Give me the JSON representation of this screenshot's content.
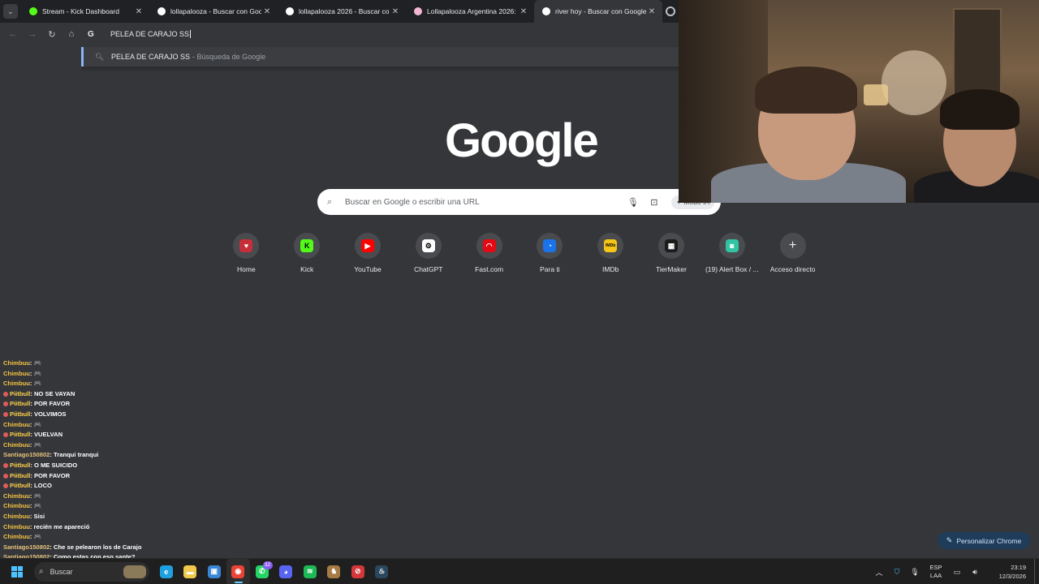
{
  "browser": {
    "tabs": [
      {
        "title": "Stream - Kick Dashboard",
        "favicon_color": "#53fc18",
        "active": false
      },
      {
        "title": "lollapalooza - Buscar con Goog",
        "favicon_color": "#ffffff",
        "active": false
      },
      {
        "title": "lollapalooza 2026 - Buscar con",
        "favicon_color": "#ffffff",
        "active": false
      },
      {
        "title": "Lollapalooza Argentina 2026: e",
        "favicon_color": "#f4b6d2",
        "active": false
      },
      {
        "title": "river hoy - Buscar con Google",
        "favicon_color": "#ffffff",
        "active": true
      }
    ],
    "tab_close_glyph": "✕",
    "omnibox": {
      "value": "PELEA DE CARAJO SS",
      "engine_icon": "G"
    },
    "suggestion": {
      "query": "PELEA DE CARAJO SS",
      "source": "- Búsqueda de Google"
    }
  },
  "ntp": {
    "logo": "Google",
    "search_placeholder": "Buscar en Google o escribir una URL",
    "ai_mode_label": "Modo IA",
    "shortcuts": [
      {
        "label": "Home",
        "icon": "home-shield-icon",
        "color": "#c62f3a",
        "glyph": "♥"
      },
      {
        "label": "Kick",
        "icon": "kick-icon",
        "color": "#53fc18",
        "glyph": "K"
      },
      {
        "label": "YouTube",
        "icon": "youtube-icon",
        "color": "#ff0000",
        "glyph": "▶"
      },
      {
        "label": "ChatGPT",
        "icon": "chatgpt-icon",
        "color": "#ffffff",
        "glyph": "⚙"
      },
      {
        "label": "Fast.com",
        "icon": "fast-icon",
        "color": "#e50914",
        "glyph": "◠"
      },
      {
        "label": "Para ti",
        "icon": "para-ti-icon",
        "color": "#1a73e8",
        "glyph": "◔"
      },
      {
        "label": "IMDb",
        "icon": "imdb-icon",
        "color": "#f5c518",
        "glyph": "IMDb"
      },
      {
        "label": "TierMaker",
        "icon": "tiermaker-icon",
        "color": "#1b1b1b",
        "glyph": "▦"
      },
      {
        "label": "(19) Alert Box / ...",
        "icon": "alert-box-icon",
        "color": "#31c3a2",
        "glyph": "◙"
      },
      {
        "label": "Acceso directo",
        "icon": "plus-icon",
        "color": "#4a4b4f",
        "glyph": "+"
      }
    ],
    "customize_label": "Personalizar Chrome"
  },
  "chat": [
    {
      "user": "Chimbuu",
      "msg": "🎮",
      "color": "#f5c542",
      "badge": false
    },
    {
      "user": "Chimbuu",
      "msg": "🎮",
      "color": "#f5c542",
      "badge": false
    },
    {
      "user": "Chimbuu",
      "msg": "🎮",
      "color": "#f5c542",
      "badge": false
    },
    {
      "user": "Piitbull",
      "msg": "NO SE VAYAN",
      "color": "#ffd24a",
      "badge": true
    },
    {
      "user": "Piitbull",
      "msg": "POR FAVOR",
      "color": "#ffd24a",
      "badge": true
    },
    {
      "user": "Piitbull",
      "msg": "VOLVIMOS",
      "color": "#ffd24a",
      "badge": true
    },
    {
      "user": "Chimbuu",
      "msg": "🎮",
      "color": "#f5c542",
      "badge": false
    },
    {
      "user": "Piitbull",
      "msg": "VUELVAN",
      "color": "#ffd24a",
      "badge": true
    },
    {
      "user": "Chimbuu",
      "msg": "🎮",
      "color": "#f5c542",
      "badge": false
    },
    {
      "user": "Santiago150802",
      "msg": "Tranqui tranqui",
      "color": "#e6c27a",
      "badge": false
    },
    {
      "user": "Piitbull",
      "msg": "O ME SUICIDO",
      "color": "#ffd24a",
      "badge": true
    },
    {
      "user": "Piitbull",
      "msg": "POR FAVOR",
      "color": "#ffd24a",
      "badge": true
    },
    {
      "user": "Piitbull",
      "msg": "LOCO",
      "color": "#ffd24a",
      "badge": true
    },
    {
      "user": "Chimbuu",
      "msg": "🎮",
      "color": "#f5c542",
      "badge": false
    },
    {
      "user": "Chimbuu",
      "msg": "🎮",
      "color": "#f5c542",
      "badge": false
    },
    {
      "user": "Chimbuu",
      "msg": "Sisi",
      "color": "#f5c542",
      "badge": false
    },
    {
      "user": "Chimbuu",
      "msg": "recién me apareció",
      "color": "#f5c542",
      "badge": false
    },
    {
      "user": "Chimbuu",
      "msg": "🎮",
      "color": "#f5c542",
      "badge": false
    },
    {
      "user": "Santiago150802",
      "msg": "Che se pelearon los de Carajo",
      "color": "#e6c27a",
      "badge": false
    },
    {
      "user": "Santiago150802",
      "msg": "Como estas con eso sante?",
      "color": "#e6c27a",
      "badge": false
    }
  ],
  "taskbar": {
    "search_label": "Buscar",
    "apps": [
      {
        "name": "edge-icon",
        "color": "#1fa0e0",
        "glyph": "e",
        "active": false,
        "badge": ""
      },
      {
        "name": "file-explorer-icon",
        "color": "#f2c94c",
        "glyph": "▬",
        "active": false,
        "badge": ""
      },
      {
        "name": "store-icon",
        "color": "#3a86d6",
        "glyph": "▣",
        "active": false,
        "badge": ""
      },
      {
        "name": "chrome-icon",
        "color": "#ea4335",
        "glyph": "◉",
        "active": true,
        "badge": ""
      },
      {
        "name": "whatsapp-icon",
        "color": "#25d366",
        "glyph": "✆",
        "active": false,
        "badge": "32"
      },
      {
        "name": "discord-icon",
        "color": "#5865f2",
        "glyph": "◕",
        "active": false,
        "badge": ""
      },
      {
        "name": "spotify-icon",
        "color": "#1db954",
        "glyph": "≋",
        "active": false,
        "badge": ""
      },
      {
        "name": "game-app-icon",
        "color": "#a77b44",
        "glyph": "♞",
        "active": false,
        "badge": ""
      },
      {
        "name": "recorder-app-icon",
        "color": "#d4373a",
        "glyph": "⊘",
        "active": false,
        "badge": ""
      },
      {
        "name": "steam-icon",
        "color": "#2a475e",
        "glyph": "♨",
        "active": false,
        "badge": ""
      }
    ],
    "tray": {
      "lang_line1": "ESP",
      "lang_line2": "LAA",
      "time": "23:19",
      "date": "12/3/2026"
    }
  }
}
